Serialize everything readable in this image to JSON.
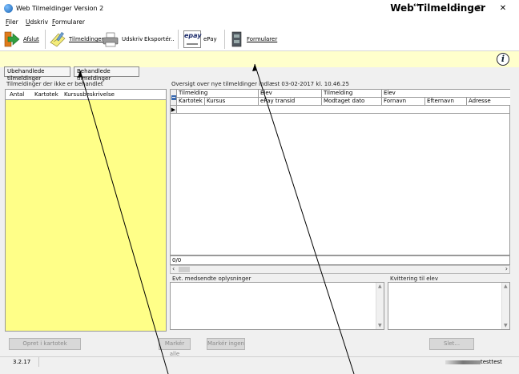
{
  "window": {
    "title": "Web Tilmeldinger Version 2",
    "resize_glyph": "↔",
    "min_glyph": "–",
    "max_glyph": "☐",
    "close_glyph": "✕"
  },
  "menu": [
    {
      "label": "Filer",
      "u": "F",
      "rest": "iler"
    },
    {
      "label": "Udskriv",
      "u": "U",
      "rest": "dskriv"
    },
    {
      "label": "Formularer",
      "u": "F",
      "rest": "ormularer"
    }
  ],
  "toolbar": {
    "afslut": "Afslut",
    "tilmeldinger": "Tilmeldinger",
    "udskriv": "Udskriv",
    "eksporter": "Eksportér..",
    "epay": "ePay",
    "epay_logo": "epay",
    "formularer": "Formularer"
  },
  "header": {
    "title": "Web Tilmeldinger",
    "info_glyph": "i"
  },
  "tabs": {
    "ubehandlede": "Ubehandlede tilmeldinger",
    "behandlede": "Behandlede tilmeldinger"
  },
  "left_panel": {
    "label": "Tilmeldinger der ikke er behandlet",
    "columns": [
      "Antal",
      "Kartotek",
      "Kursusbeskrivelse"
    ]
  },
  "grid": {
    "label": "Oversigt over nye tilmeldinger indlæst 03-02-2017 kl. 10.46.25",
    "group_headers": [
      "Tilmelding",
      "Elev",
      "Tilmelding",
      "Elev"
    ],
    "columns": [
      "Kartotek",
      "Kursus",
      "ePay transid",
      "Modtaget dato",
      "Fornavn",
      "Efternavn",
      "Adresse"
    ],
    "row_pointer": "▶",
    "record_nav": "0/0"
  },
  "memos": {
    "oplysninger": "Evt. medsendte oplysninger",
    "kvittering": "Kvittering til elev"
  },
  "buttons": {
    "opret": "Opret i kartotek",
    "marker_alle": "Markér alle",
    "marker_ingen": "Markér ingen",
    "slet": "Slet..."
  },
  "status": {
    "version": "3.2.17",
    "user": "testtest"
  },
  "colors": {
    "left_list_bg": "#ffff88",
    "header_strip_bg": "#ffffcc",
    "exit_arrow": "#e07a1a",
    "exit_green": "#2f9e3f"
  }
}
